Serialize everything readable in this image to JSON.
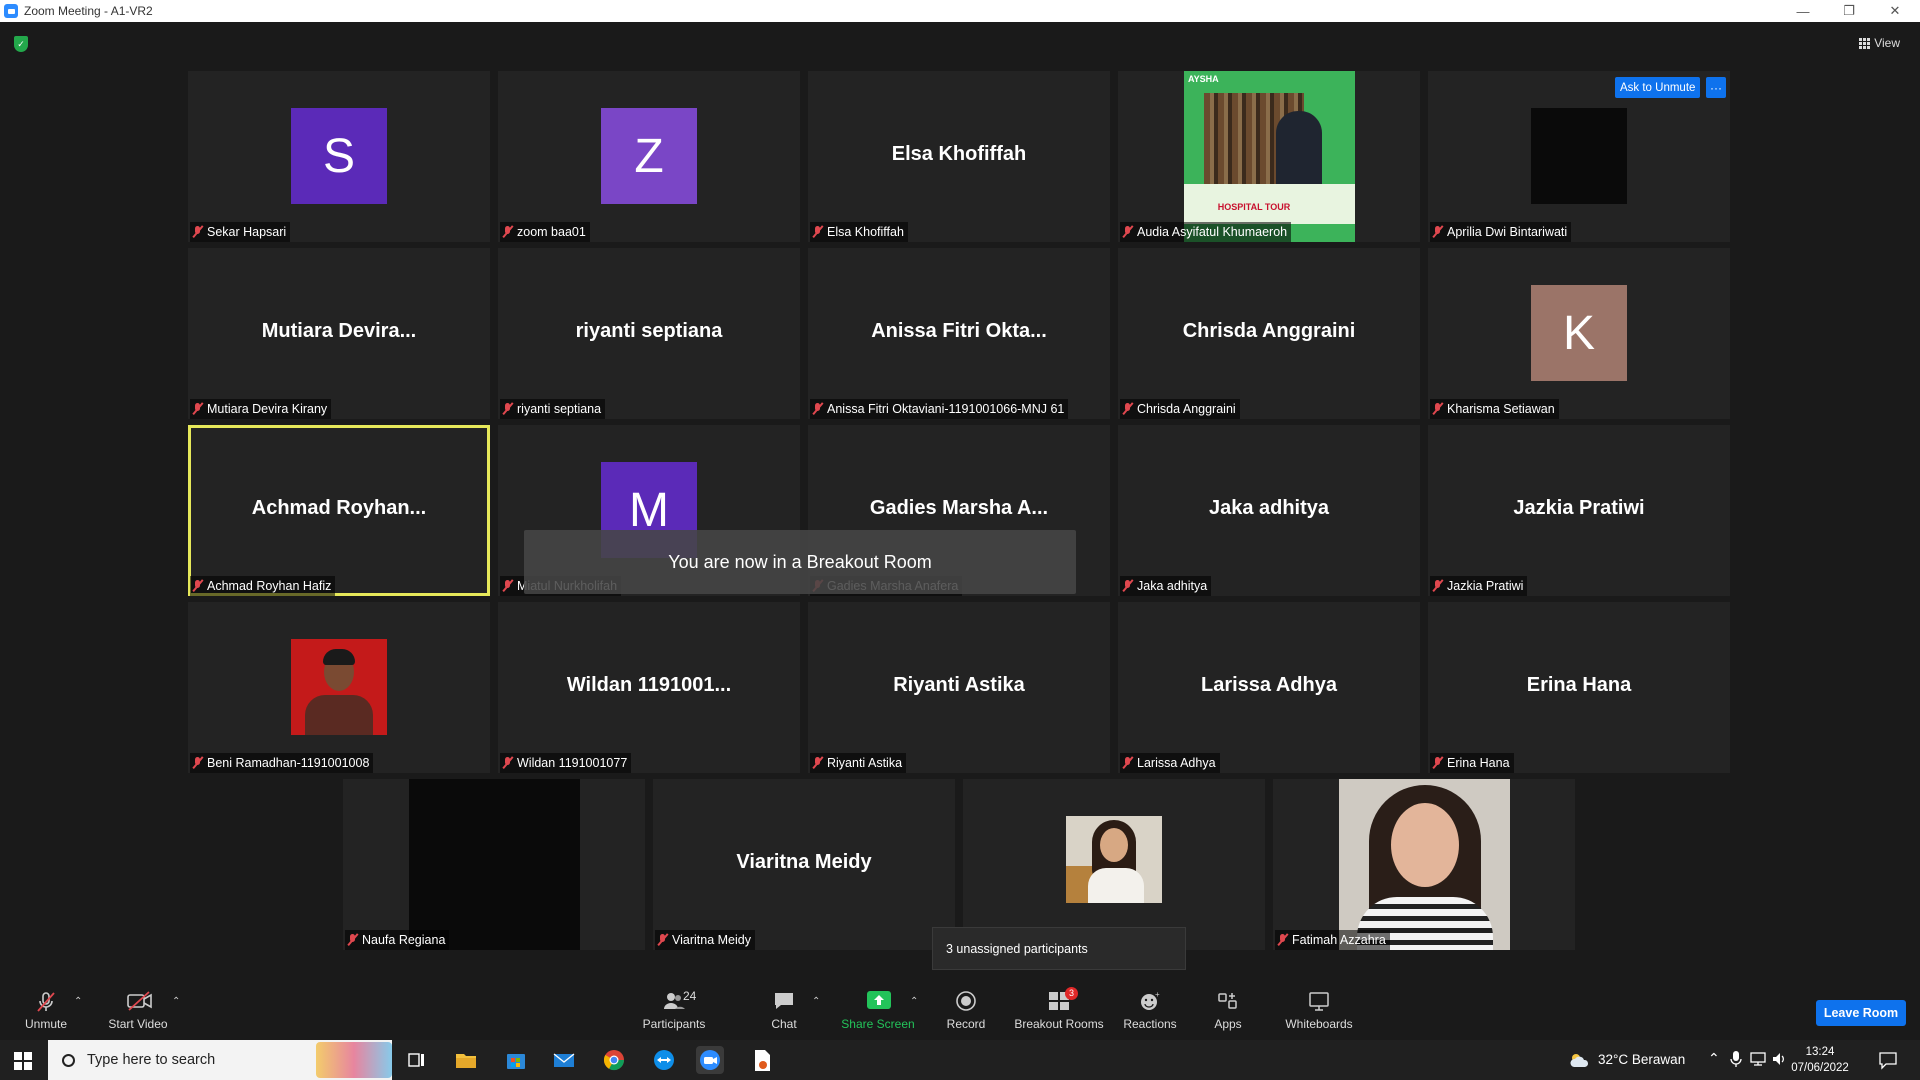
{
  "window": {
    "title": "Zoom Meeting - A1-VR2"
  },
  "top_bar": {
    "view_label": "View"
  },
  "tiles": [
    {
      "name": "Sekar Hapsari",
      "type": "initial",
      "initial": "S",
      "color": "#5b2ab8"
    },
    {
      "name": "zoom baa01",
      "type": "initial",
      "initial": "Z",
      "color": "#7a46c6"
    },
    {
      "name": "Elsa Khofiffah",
      "type": "name",
      "display": "Elsa Khofiffah"
    },
    {
      "name": "Audia Asyifatul Khumaeroh",
      "type": "poster",
      "poster_brand": "AYSHA",
      "poster_text": "HOSPITAL TOUR"
    },
    {
      "name": "Aprilia Dwi Bintariwati",
      "type": "black",
      "ask_unmute": "Ask to Unmute"
    },
    {
      "name": "Mutiara Devira Kirany",
      "type": "name",
      "display": "Mutiara  Devira..."
    },
    {
      "name": "riyanti septiana",
      "type": "name",
      "display": "riyanti septiana"
    },
    {
      "name": "Anissa Fitri Oktaviani-1191001066-MNJ 61",
      "type": "name",
      "display": "Anissa  Fitri  Okta..."
    },
    {
      "name": "Chrisda Anggraini",
      "type": "name",
      "display": "Chrisda Anggraini"
    },
    {
      "name": "Kharisma Setiawan",
      "type": "initial",
      "initial": "K",
      "color": "#9b7468"
    },
    {
      "name": "Achmad Royhan Hafiz",
      "type": "name",
      "display": "Achmad  Royhan...",
      "active": true
    },
    {
      "name": "Miatul Nurkholifah",
      "type": "initial",
      "initial": "M",
      "color": "#5b2ab8"
    },
    {
      "name": "Gadies Marsha Anafera",
      "type": "name",
      "display": "Gadies Marsha A..."
    },
    {
      "name": "Jaka adhitya",
      "type": "name",
      "display": "Jaka adhitya"
    },
    {
      "name": "Jazkia Pratiwi",
      "type": "name",
      "display": "Jazkia Pratiwi"
    },
    {
      "name": "Beni Ramadhan-1191001008",
      "type": "photo-man"
    },
    {
      "name": "Wildan 1191001077",
      "type": "name",
      "display": "Wildan  1191001..."
    },
    {
      "name": "Riyanti Astika",
      "type": "name",
      "display": "Riyanti Astika"
    },
    {
      "name": "Larissa Adhya",
      "type": "name",
      "display": "Larissa Adhya"
    },
    {
      "name": "Erina Hana",
      "type": "name",
      "display": "Erina Hana"
    },
    {
      "name": "Naufa Regiana",
      "type": "black-video"
    },
    {
      "name": "Viaritna Meidy",
      "type": "name",
      "display": "Viaritna Meidy"
    },
    {
      "name": "",
      "type": "photo-girl-small"
    },
    {
      "name": "Fatimah Azzahra",
      "type": "photo-girl-large"
    }
  ],
  "toast": "You are now in a Breakout Room",
  "unassigned_popup": "3 unassigned participants",
  "toolbar": {
    "unmute": "Unmute",
    "start_video": "Start Video",
    "participants": "Participants",
    "participants_count": "24",
    "chat": "Chat",
    "share_screen": "Share Screen",
    "record": "Record",
    "breakout_rooms": "Breakout Rooms",
    "breakout_badge": "3",
    "reactions": "Reactions",
    "apps": "Apps",
    "whiteboards": "Whiteboards",
    "leave": "Leave Room",
    "share_color": "#23c35a"
  },
  "taskbar": {
    "search_placeholder": "Type here to search",
    "weather": "32°C  Berawan",
    "time": "13:24",
    "date": "07/06/2022"
  }
}
